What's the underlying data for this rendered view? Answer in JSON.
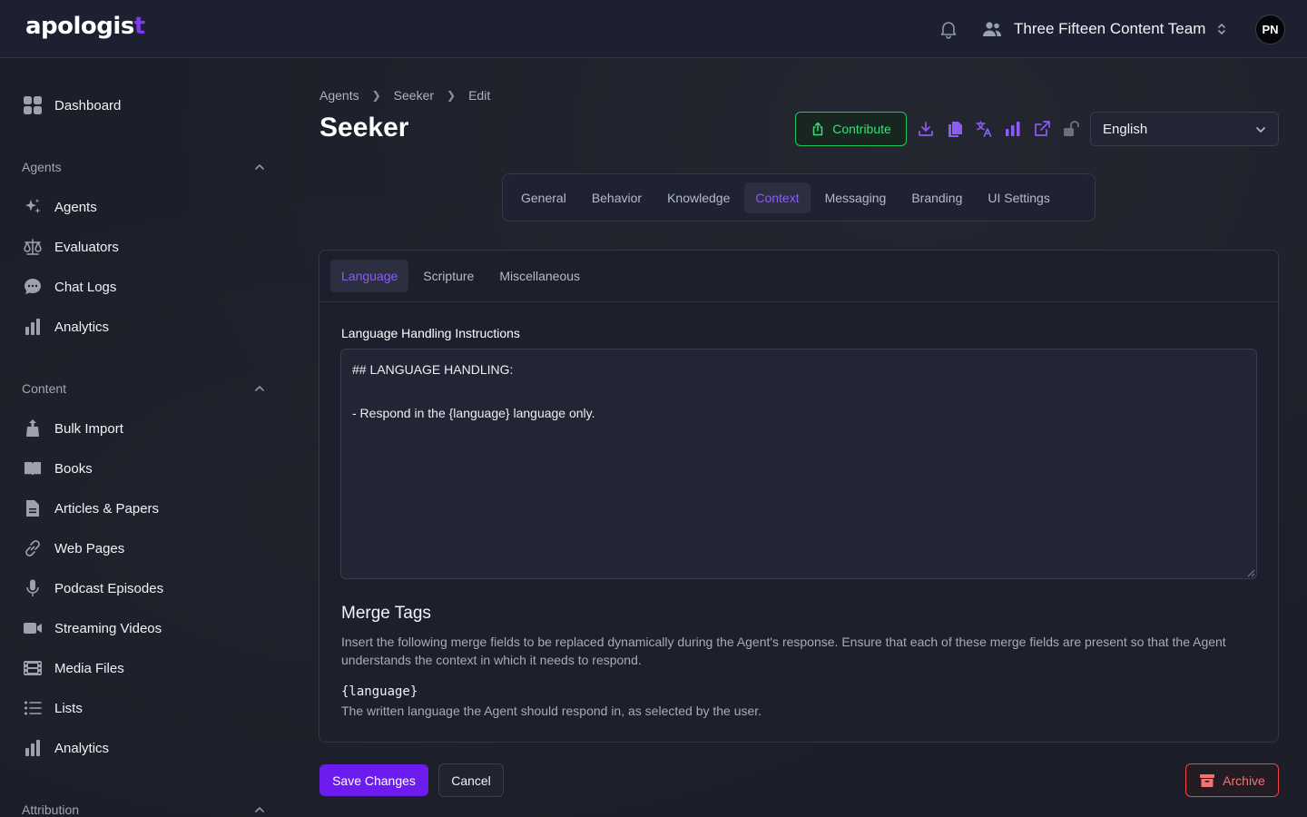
{
  "app": {
    "logo_text": "apologis",
    "logo_cross": "t"
  },
  "header": {
    "team_name": "Three Fifteen Content Team",
    "avatar_initials": "PN"
  },
  "sidebar": {
    "dashboard": "Dashboard",
    "sections": [
      {
        "title": "Agents",
        "items": [
          "Agents",
          "Evaluators",
          "Chat Logs",
          "Analytics"
        ]
      },
      {
        "title": "Content",
        "items": [
          "Bulk Import",
          "Books",
          "Articles & Papers",
          "Web Pages",
          "Podcast Episodes",
          "Streaming Videos",
          "Media Files",
          "Lists",
          "Analytics"
        ]
      },
      {
        "title": "Attribution"
      }
    ]
  },
  "breadcrumb": [
    "Agents",
    "Seeker",
    "Edit"
  ],
  "page_title": "Seeker",
  "toolbar": {
    "contribute_label": "Contribute",
    "language_value": "English"
  },
  "tabs": [
    "General",
    "Behavior",
    "Knowledge",
    "Context",
    "Messaging",
    "Branding",
    "UI Settings"
  ],
  "active_tab": "Context",
  "subtabs": [
    "Language",
    "Scripture",
    "Miscellaneous"
  ],
  "active_subtab": "Language",
  "form": {
    "label": "Language Handling Instructions",
    "value": "## LANGUAGE HANDLING:\n\n- Respond in the {language} language only."
  },
  "merge_tags": {
    "heading": "Merge Tags",
    "description": "Insert the following merge fields to be replaced dynamically during the Agent's response. Ensure that each of these merge fields are present so that the Agent understands the context in which it needs to respond.",
    "tag": "{language}",
    "tag_description": "The written language the Agent should respond in, as selected by the user."
  },
  "actions": {
    "save": "Save Changes",
    "cancel": "Cancel",
    "archive": "Archive"
  },
  "colors": {
    "accent": "#7c3aed",
    "contribute": "#22c55e",
    "danger": "#ef4444"
  }
}
